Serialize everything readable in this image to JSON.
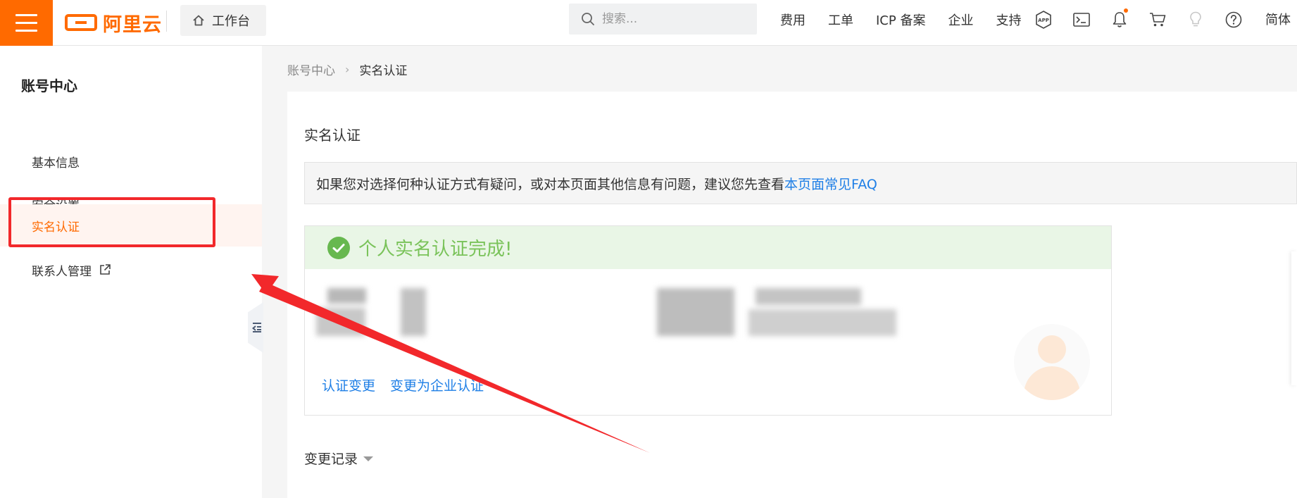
{
  "topbar": {
    "logo_text": "阿里云",
    "workbench_label": "工作台",
    "search_placeholder": "搜索...",
    "nav_links": [
      "费用",
      "工单",
      "ICP 备案",
      "企业",
      "支持"
    ],
    "lang": "简体",
    "accent_color": "#ff6a00"
  },
  "sidebar": {
    "title": "账号中心",
    "items": [
      {
        "label": "基本信息"
      },
      {
        "label": "安全设置"
      },
      {
        "label": "实名认证",
        "active": true
      },
      {
        "label": "联系人管理",
        "external": true
      }
    ]
  },
  "breadcrumb": {
    "parent": "账号中心",
    "separator": "›",
    "current": "实名认证"
  },
  "main": {
    "title": "实名认证",
    "notice_text": "如果您对选择何种认证方式有疑问，或对本页面其他信息有问题，建议您先查看",
    "notice_link": "本页面常见FAQ",
    "status_text": "个人实名认证完成!",
    "links": [
      "认证变更",
      "变更为企业认证"
    ],
    "history_label": "变更记录"
  },
  "annotation": {
    "color": "#f2282b"
  }
}
